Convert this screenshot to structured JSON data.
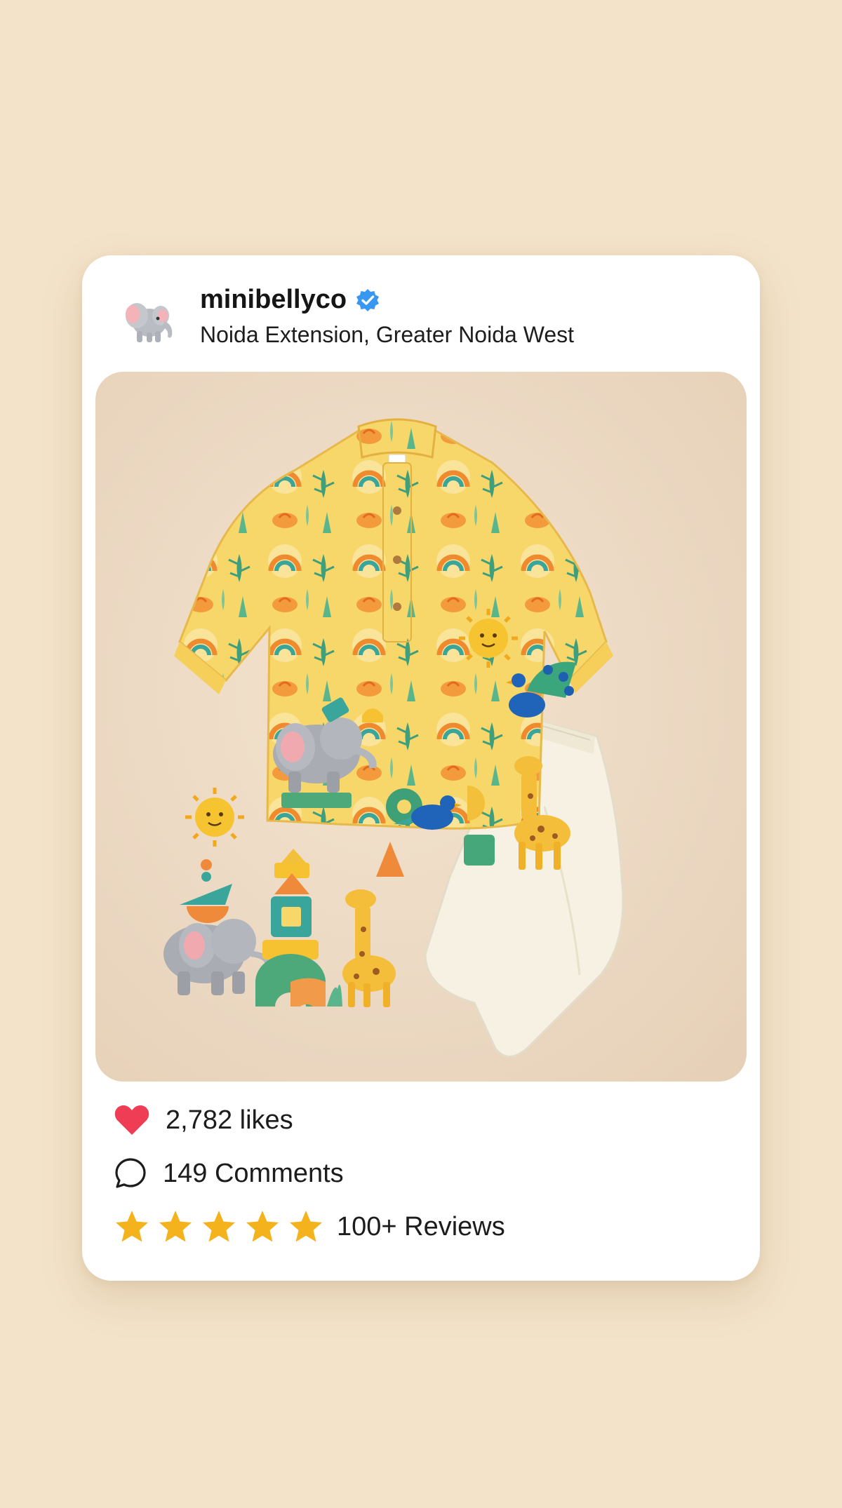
{
  "post": {
    "username": "minibellyco",
    "location": "Noida Extension, Greater Noida West",
    "verified": true,
    "avatar_icon": "elephant-avatar-icon"
  },
  "engagement": {
    "likes_text": "2,782 likes",
    "comments_text": "149 Comments",
    "reviews_text": "100+ Reviews",
    "rating_stars": 5
  },
  "colors": {
    "background": "#f3e3c9",
    "card": "#ffffff",
    "heart": "#ef3d56",
    "star": "#f4b21c",
    "verified": "#3897f0"
  }
}
